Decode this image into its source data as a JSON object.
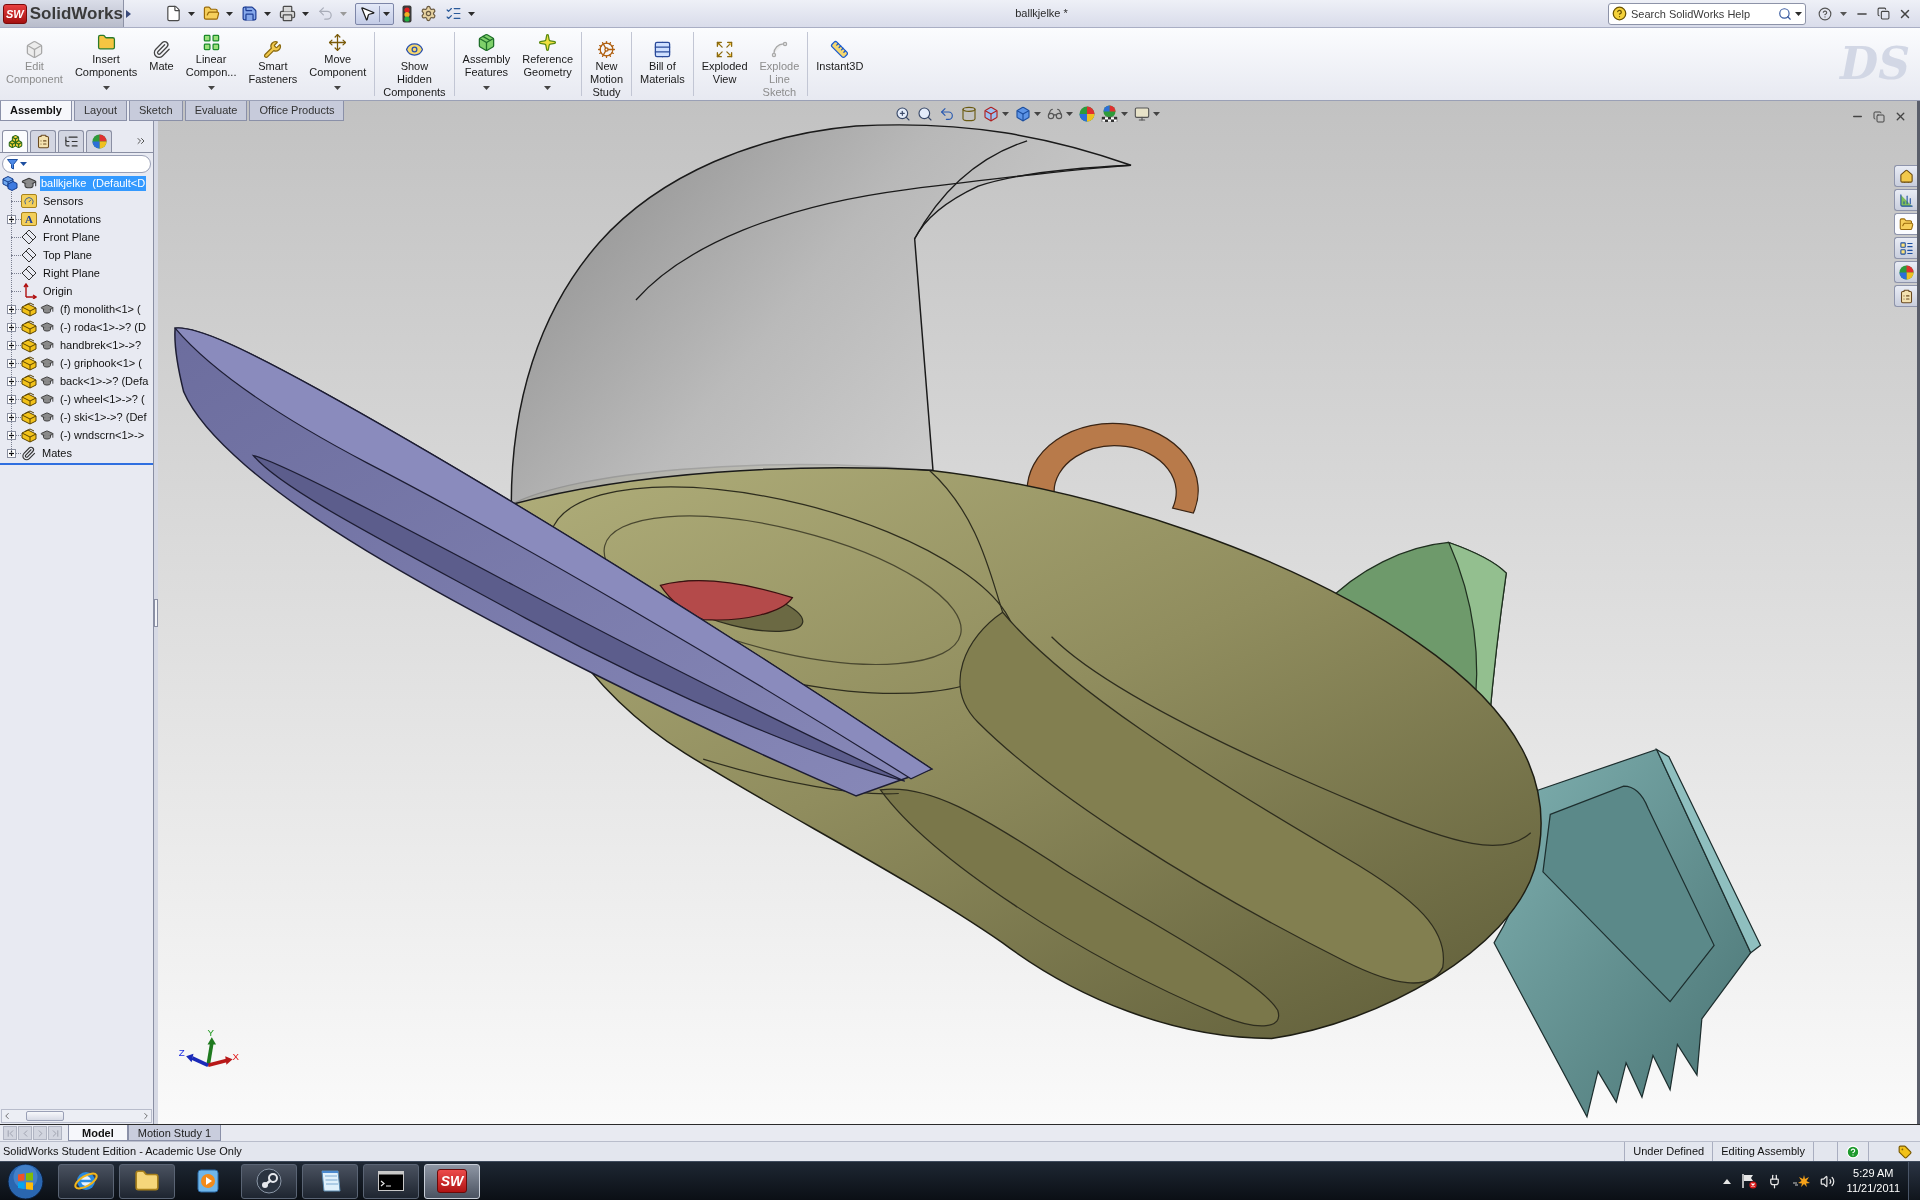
{
  "title_bar": {
    "logo_badge": "SW",
    "logo_text": "SolidWorks",
    "document_title": "ballkjelke *",
    "search": {
      "placeholder": "Search SolidWorks Help"
    }
  },
  "quick_access": [
    {
      "kind": "new",
      "menu": true,
      "pressed": false,
      "disabled": false
    },
    {
      "kind": "open",
      "menu": true,
      "pressed": false,
      "disabled": false
    },
    {
      "kind": "save",
      "menu": true,
      "pressed": false,
      "disabled": false
    },
    {
      "kind": "print",
      "menu": true,
      "pressed": false,
      "disabled": false
    },
    {
      "kind": "undo",
      "menu": true,
      "pressed": false,
      "disabled": true
    },
    {
      "kind": "select",
      "menu": true,
      "pressed": true,
      "disabled": false
    },
    {
      "kind": "rebuild",
      "menu": false,
      "pressed": false,
      "disabled": false
    },
    {
      "kind": "options",
      "menu": false,
      "pressed": false,
      "disabled": false
    },
    {
      "kind": "checklist",
      "menu": true,
      "pressed": false,
      "disabled": false
    }
  ],
  "ribbon": {
    "groups": [
      [
        {
          "kind": "edit_component",
          "label": "Edit Component",
          "menu": false,
          "disabled": true
        },
        {
          "kind": "insert_components",
          "label": "Insert Components",
          "menu": true,
          "disabled": false
        },
        {
          "kind": "mate",
          "label": "Mate",
          "menu": false,
          "disabled": false
        },
        {
          "kind": "linear_pattern",
          "label": "Linear Compon...",
          "menu": true,
          "disabled": false
        },
        {
          "kind": "smart_fasteners",
          "label": "Smart Fasteners",
          "menu": false,
          "disabled": false
        },
        {
          "kind": "move_component",
          "label": "Move Component",
          "menu": true,
          "disabled": false
        }
      ],
      [
        {
          "kind": "show_hidden",
          "label": "Show Hidden Components",
          "menu": false,
          "disabled": false
        }
      ],
      [
        {
          "kind": "assembly_features",
          "label": "Assembly Features",
          "menu": true,
          "disabled": false
        },
        {
          "kind": "reference_geometry",
          "label": "Reference Geometry",
          "menu": true,
          "disabled": false
        }
      ],
      [
        {
          "kind": "motion_study",
          "label": "New Motion Study",
          "menu": false,
          "disabled": false
        }
      ],
      [
        {
          "kind": "bom",
          "label": "Bill of Materials",
          "menu": false,
          "disabled": false
        }
      ],
      [
        {
          "kind": "exploded_view",
          "label": "Exploded View",
          "menu": false,
          "disabled": false
        },
        {
          "kind": "explode_line",
          "label": "Explode Line Sketch",
          "menu": false,
          "disabled": true
        }
      ],
      [
        {
          "kind": "instant3d",
          "label": "Instant3D",
          "menu": false,
          "disabled": false
        }
      ]
    ],
    "logo_text": "DS"
  },
  "command_tabs": [
    {
      "label": "Assembly",
      "selected": true
    },
    {
      "label": "Layout",
      "selected": false
    },
    {
      "label": "Sketch",
      "selected": false
    },
    {
      "label": "Evaluate",
      "selected": false
    },
    {
      "label": "Office Products",
      "selected": false
    }
  ],
  "feature_manager": {
    "tabs": [
      {
        "kind": "feature_tree",
        "selected": true
      },
      {
        "kind": "properties",
        "selected": false
      },
      {
        "kind": "configurations",
        "selected": false
      },
      {
        "kind": "display",
        "selected": false
      }
    ],
    "tree": {
      "kind": "assembly",
      "label": "ballkjelke  (Default<D",
      "selected": true,
      "children": [
        {
          "kind": "sensors",
          "label": "Sensors",
          "selected": false
        },
        {
          "kind": "annotations",
          "label": "Annotations",
          "badge": "A",
          "expanded": false,
          "selected": false
        },
        {
          "kind": "plane",
          "label": "Front Plane",
          "selected": false
        },
        {
          "kind": "plane",
          "label": "Top Plane",
          "selected": false
        },
        {
          "kind": "plane",
          "label": "Right Plane",
          "selected": false
        },
        {
          "kind": "origin",
          "label": "Origin",
          "selected": false
        },
        {
          "kind": "part",
          "label": "(f) monolith<1> (",
          "expanded": false,
          "selected": false
        },
        {
          "kind": "part",
          "label": "(-) roda<1>->? (D",
          "expanded": false,
          "selected": false
        },
        {
          "kind": "part",
          "label": "handbrek<1>->?",
          "expanded": false,
          "selected": false
        },
        {
          "kind": "part",
          "label": "(-) griphook<1> (",
          "expanded": false,
          "selected": false
        },
        {
          "kind": "part",
          "label": "back<1>->? (Defa",
          "expanded": false,
          "selected": false
        },
        {
          "kind": "part",
          "label": "(-) wheel<1>->? (",
          "expanded": false,
          "selected": false
        },
        {
          "kind": "part",
          "label": "(-) ski<1>->? (Def",
          "expanded": false,
          "selected": false
        },
        {
          "kind": "part",
          "label": "(-) wndscrn<1>->",
          "expanded": false,
          "selected": false
        },
        {
          "kind": "mates",
          "label": "Mates",
          "expanded": false,
          "selected": false
        }
      ]
    }
  },
  "viewport": {
    "heads_up_toolbar": [
      {
        "kind": "zoom_fit",
        "menu": false
      },
      {
        "kind": "zoom_area",
        "menu": false
      },
      {
        "kind": "previous_view",
        "menu": false
      },
      {
        "kind": "section_view",
        "menu": false
      },
      {
        "kind": "orientation",
        "menu": true
      },
      {
        "kind": "display_style",
        "menu": true
      },
      {
        "kind": "hide_show",
        "menu": true
      },
      {
        "kind": "appearance",
        "menu": false
      },
      {
        "kind": "scene",
        "menu": true
      },
      {
        "kind": "view_settings",
        "menu": true
      }
    ],
    "task_pane": [
      {
        "kind": "home",
        "selected": false
      },
      {
        "kind": "library",
        "selected": false
      },
      {
        "kind": "explorer",
        "selected": true
      },
      {
        "kind": "view_palette",
        "selected": false
      },
      {
        "kind": "appearances",
        "selected": false
      },
      {
        "kind": "properties",
        "selected": false
      }
    ],
    "triad": {
      "y": "Y",
      "z": "Z",
      "x": "X"
    }
  },
  "bottom_tabs": [
    {
      "label": "Model",
      "selected": true
    },
    {
      "label": "Motion Study 1",
      "selected": false
    }
  ],
  "status_bar": {
    "message": "SolidWorks Student Edition - Academic Use Only",
    "fields": [
      "Under Defined",
      "Editing Assembly"
    ]
  },
  "taskbar": {
    "apps": [
      {
        "kind": "browser",
        "running": true,
        "active": false
      },
      {
        "kind": "explorer",
        "running": true,
        "active": false
      },
      {
        "kind": "media_player",
        "running": false,
        "active": false
      },
      {
        "kind": "steam",
        "running": true,
        "active": false
      },
      {
        "kind": "notepad",
        "running": true,
        "active": false
      },
      {
        "kind": "terminal",
        "running": true,
        "active": false
      },
      {
        "kind": "solidworks",
        "running": true,
        "active": true,
        "badge": "SW"
      }
    ],
    "tray": [
      {
        "kind": "show_hidden"
      },
      {
        "kind": "action_center"
      },
      {
        "kind": "power"
      },
      {
        "kind": "network"
      },
      {
        "kind": "volume"
      }
    ],
    "time": "5:29 AM",
    "date": "11/21/2011"
  }
}
